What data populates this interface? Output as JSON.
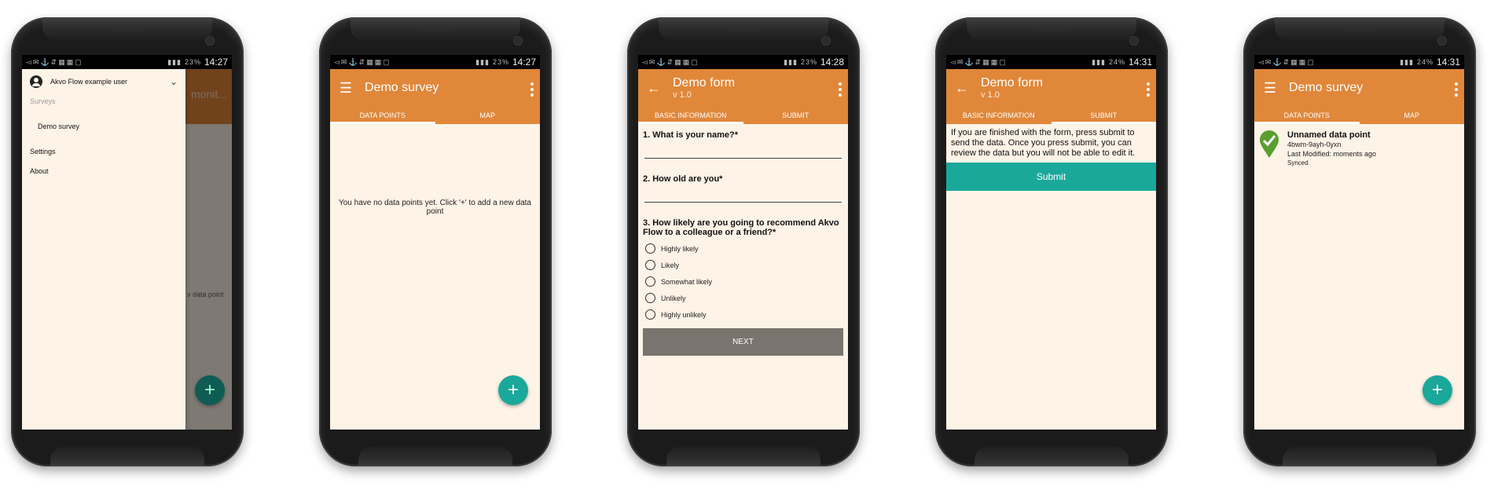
{
  "status_icons": "◅✉⚓⇵▦▦▢",
  "screens": [
    {
      "time": "14:27",
      "battery": "23%",
      "drawer": {
        "user": "Akvo Flow example user",
        "section_label": "Surveys",
        "survey_item": "Demo survey",
        "settings": "Settings",
        "about": "About"
      },
      "underlay_title": "monit...",
      "underlay_empty": "v data point"
    },
    {
      "time": "14:27",
      "battery": "23%",
      "title": "Demo survey",
      "tabs": [
        "DATA POINTS",
        "MAP"
      ],
      "empty_text": "You have no data points yet. Click '+' to add a new data point"
    },
    {
      "time": "14:28",
      "battery": "23%",
      "title": "Demo form",
      "subtitle": "v 1.0",
      "tabs": [
        "BASIC INFORMATION",
        "SUBMIT"
      ],
      "questions": [
        "1. What is your name?*",
        "2. How old are you*",
        "3. How likely are you going to recommend Akvo Flow to a colleague or a friend?*"
      ],
      "options": [
        "Highly likely",
        "Likely",
        "Somewhat likely",
        "Unlikely",
        "Highly unlikely"
      ],
      "next_label": "NEXT"
    },
    {
      "time": "14:31",
      "battery": "24%",
      "title": "Demo form",
      "subtitle": "v 1.0",
      "tabs": [
        "BASIC INFORMATION",
        "SUBMIT"
      ],
      "message": "If you are finished with the form, press submit to send the data. Once you press submit, you can review the data but you will not be able to edit it.",
      "submit_label": "Submit"
    },
    {
      "time": "14:31",
      "battery": "24%",
      "title": "Demo survey",
      "tabs": [
        "DATA POINTS",
        "MAP"
      ],
      "datapoint": {
        "name": "Unnamed data point",
        "id": "4bwm-9ayh-0yxn",
        "modified": "Last Modified: moments ago",
        "status": "Synced"
      }
    }
  ],
  "colors": {
    "appbar": "#e0873a",
    "accent": "#1aa89b",
    "background": "#fdf3e7",
    "next_button": "#7a746e",
    "check": "#5a9e2f"
  }
}
